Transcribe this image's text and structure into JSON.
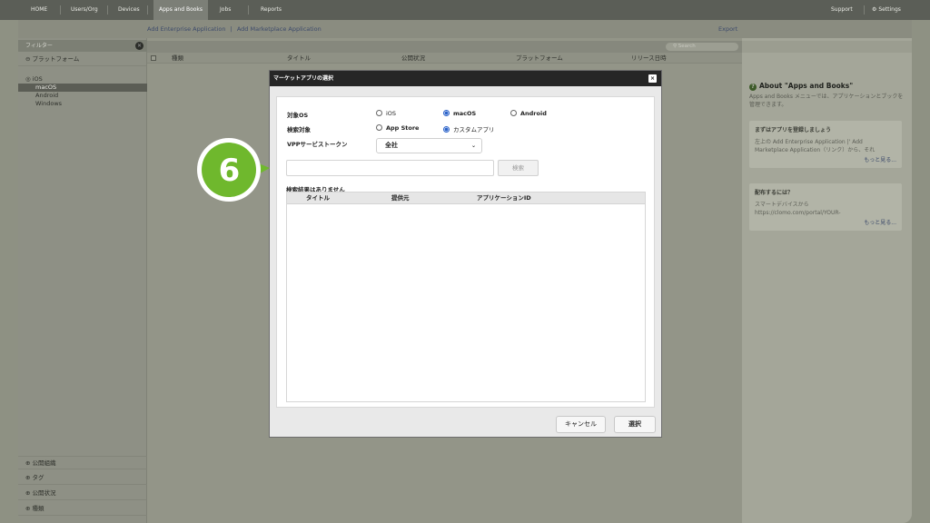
{
  "nav": {
    "items": [
      "HOME",
      "Users/Org",
      "Devices",
      "Apps and Books",
      "Jobs",
      "Reports"
    ],
    "support": "Support",
    "settings": "Settings"
  },
  "links": {
    "add_enterprise": "Add Enterprise Application",
    "separator": "|",
    "add_marketplace": "Add Marketplace Application",
    "export": "Export"
  },
  "sidebar": {
    "filter_label": "フィルター",
    "platform_header": "プラットフォーム",
    "platforms": [
      "iOS",
      "macOS",
      "Android",
      "Windows"
    ],
    "selected_platform": "macOS",
    "bottom_sections": [
      "公開組織",
      "タグ",
      "公開状況",
      "種類"
    ]
  },
  "main": {
    "search_placeholder": "Search",
    "columns": [
      "種類",
      "タイトル",
      "公開状況",
      "プラットフォーム",
      "リリース日時"
    ]
  },
  "right_panel": {
    "title": "About \"Apps and Books\"",
    "description": "Apps and Books メニューでは、アプリケーションとブックを管理できます。",
    "box1": {
      "heading": "まずはアプリを登録しましょう",
      "text": "左上の Add Enterprise Application |' Add Marketplace Application（リンク）から、それ",
      "more": "もっと見る..."
    },
    "box2": {
      "heading": "配布するには？",
      "text": "スマートデバイスから https://clomo.com/portal/YOUR-",
      "more": "もっと見る..."
    }
  },
  "modal": {
    "title": "マーケットアプリの選択",
    "close": "×",
    "os_label": "対象OS",
    "os_options": [
      "iOS",
      "macOS",
      "Android"
    ],
    "os_selected": "macOS",
    "target_label": "検索対象",
    "target_options": [
      "App Store",
      "カスタムアプリ"
    ],
    "target_selected": "カスタムアプリ",
    "vpp_label": "VPPサービストークン",
    "vpp_value": "全社",
    "search_value": "",
    "search_button": "検索",
    "no_results": "検索結果はありません",
    "table_columns": [
      "タイトル",
      "提供元",
      "アプリケーションID"
    ],
    "cancel_button": "キャンセル",
    "select_button": "選択"
  },
  "callout": {
    "number": "6",
    "color": "#6fb82d"
  }
}
